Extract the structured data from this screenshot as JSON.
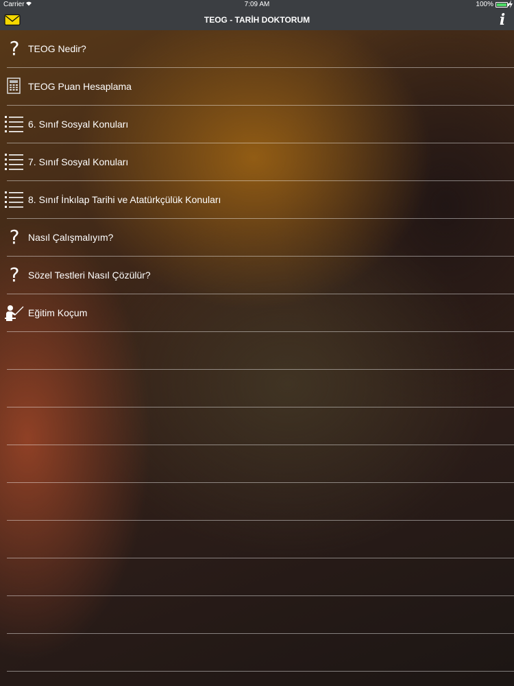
{
  "status_bar": {
    "carrier": "Carrier",
    "time": "7:09 AM",
    "battery": "100%"
  },
  "nav": {
    "title": "TEOG - TARİH DOKTORUM",
    "left_icon": "mail-icon",
    "right_icon": "info-icon",
    "accent_color": "#f5d800"
  },
  "menu": {
    "items": [
      {
        "label": "TEOG Nedir?",
        "icon": "question-icon"
      },
      {
        "label": "TEOG Puan Hesaplama",
        "icon": "calculator-icon"
      },
      {
        "label": "6. Sınıf Sosyal Konuları",
        "icon": "list-icon"
      },
      {
        "label": "7. Sınıf Sosyal Konuları",
        "icon": "list-icon"
      },
      {
        "label": "8. Sınıf İnkılap Tarihi ve Atatürkçülük Konuları",
        "icon": "list-icon"
      },
      {
        "label": "Nasıl Çalışmalıyım?",
        "icon": "question-icon"
      },
      {
        "label": "Sözel Testleri Nasıl Çözülür?",
        "icon": "question-icon"
      },
      {
        "label": "Eğitim Koçum",
        "icon": "teacher-icon"
      }
    ]
  }
}
